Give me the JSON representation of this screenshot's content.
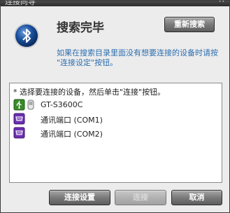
{
  "window": {
    "title": "连接向导",
    "close_glyph": "×"
  },
  "header": {
    "title": "搜索完毕",
    "rescan_label": "重新搜索",
    "hint": "如果在搜索目录里面没有想要连接的设备时请按 \"连接设定\"按钮。"
  },
  "list": {
    "instruction": "* 选择要连接的设备，然后单击\"连接\"按钮。",
    "items": [
      {
        "label": "GT-S3600C",
        "icon": "usb-device-icon",
        "icon2": "phone-icon"
      },
      {
        "label": "通讯端口 (COM1)",
        "icon": "com-port-icon"
      },
      {
        "label": "通讯端口 (COM2)",
        "icon": "com-port-icon"
      }
    ]
  },
  "footer": {
    "connect_settings_label": "连接设置",
    "connect_label": "连接",
    "cancel_label": "取消"
  },
  "colors": {
    "hint_text": "#2e6fb0",
    "bluetooth_blue": "#1a4f9c",
    "com_icon_purple": "#6a2fb0"
  }
}
